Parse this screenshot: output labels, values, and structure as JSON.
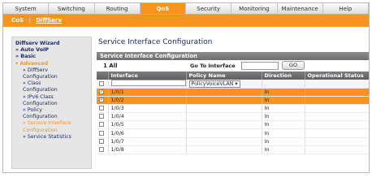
{
  "topnav": [
    "System",
    "Switching",
    "Routing",
    "QoS",
    "Security",
    "Monitoring",
    "Maintenance",
    "Help"
  ],
  "subnav": {
    "items": [
      "CoS",
      "DiffServ"
    ],
    "separator": "|"
  },
  "sidebar": {
    "items": [
      {
        "label": "Diffserv Wizard",
        "style": "bold"
      },
      {
        "label": "Auto VoIP",
        "style": "bold",
        "prefix": "»"
      },
      {
        "label": "Basic",
        "style": "bold",
        "prefix": "»"
      },
      {
        "label": "Advanced",
        "style": "adv",
        "prefix": "▾"
      },
      {
        "label": "DiffServ",
        "style": "sub",
        "prefix": "»"
      },
      {
        "label": "Configuration",
        "style": "sub"
      },
      {
        "label": "Class",
        "style": "sub",
        "prefix": "»"
      },
      {
        "label": "Configuration",
        "style": "sub"
      },
      {
        "label": "IPv6 Class",
        "style": "sub",
        "prefix": "»"
      },
      {
        "label": "Configuration",
        "style": "sub"
      },
      {
        "label": "Policy",
        "style": "sub",
        "prefix": "»"
      },
      {
        "label": "Configuration",
        "style": "sub"
      },
      {
        "label": "Service Interface",
        "style": "sub active",
        "prefix": "»"
      },
      {
        "label": "Configuration",
        "style": "sub active"
      },
      {
        "label": "Service Statistics",
        "style": "sub",
        "prefix": "»"
      }
    ]
  },
  "page_title": "Service Interface Configuration",
  "panel": {
    "header": "Service Interface Configuration",
    "all_label": "1 All",
    "goto_label": "Go To Interface",
    "go_button": "GO",
    "info_icon": "?"
  },
  "table": {
    "columns": [
      "Interface",
      "Policy Name",
      "Direction",
      "Operational Status"
    ],
    "edit_row": {
      "policy_select": "PolicyVoiceVLAN"
    },
    "rows": [
      {
        "interface": "1/0/1",
        "policy": "",
        "direction": "In",
        "status": "",
        "checked": true,
        "selected": true
      },
      {
        "interface": "1/0/2",
        "policy": "",
        "direction": "In",
        "status": "",
        "checked": true,
        "selected": true
      },
      {
        "interface": "1/0/3",
        "policy": "",
        "direction": "In",
        "status": "",
        "checked": false,
        "selected": false
      },
      {
        "interface": "1/0/4",
        "policy": "",
        "direction": "In",
        "status": "",
        "checked": false,
        "selected": false
      },
      {
        "interface": "1/0/5",
        "policy": "",
        "direction": "In",
        "status": "",
        "checked": false,
        "selected": false
      },
      {
        "interface": "1/0/6",
        "policy": "",
        "direction": "In",
        "status": "",
        "checked": false,
        "selected": false
      },
      {
        "interface": "1/0/7",
        "policy": "",
        "direction": "In",
        "status": "",
        "checked": false,
        "selected": false
      },
      {
        "interface": "1/0/8",
        "policy": "",
        "direction": "In",
        "status": "",
        "checked": false,
        "selected": false
      }
    ]
  },
  "colors": {
    "accent": "#f7941d",
    "nav_text": "#1b2a6b",
    "header_gray": "#6e6e6e"
  }
}
